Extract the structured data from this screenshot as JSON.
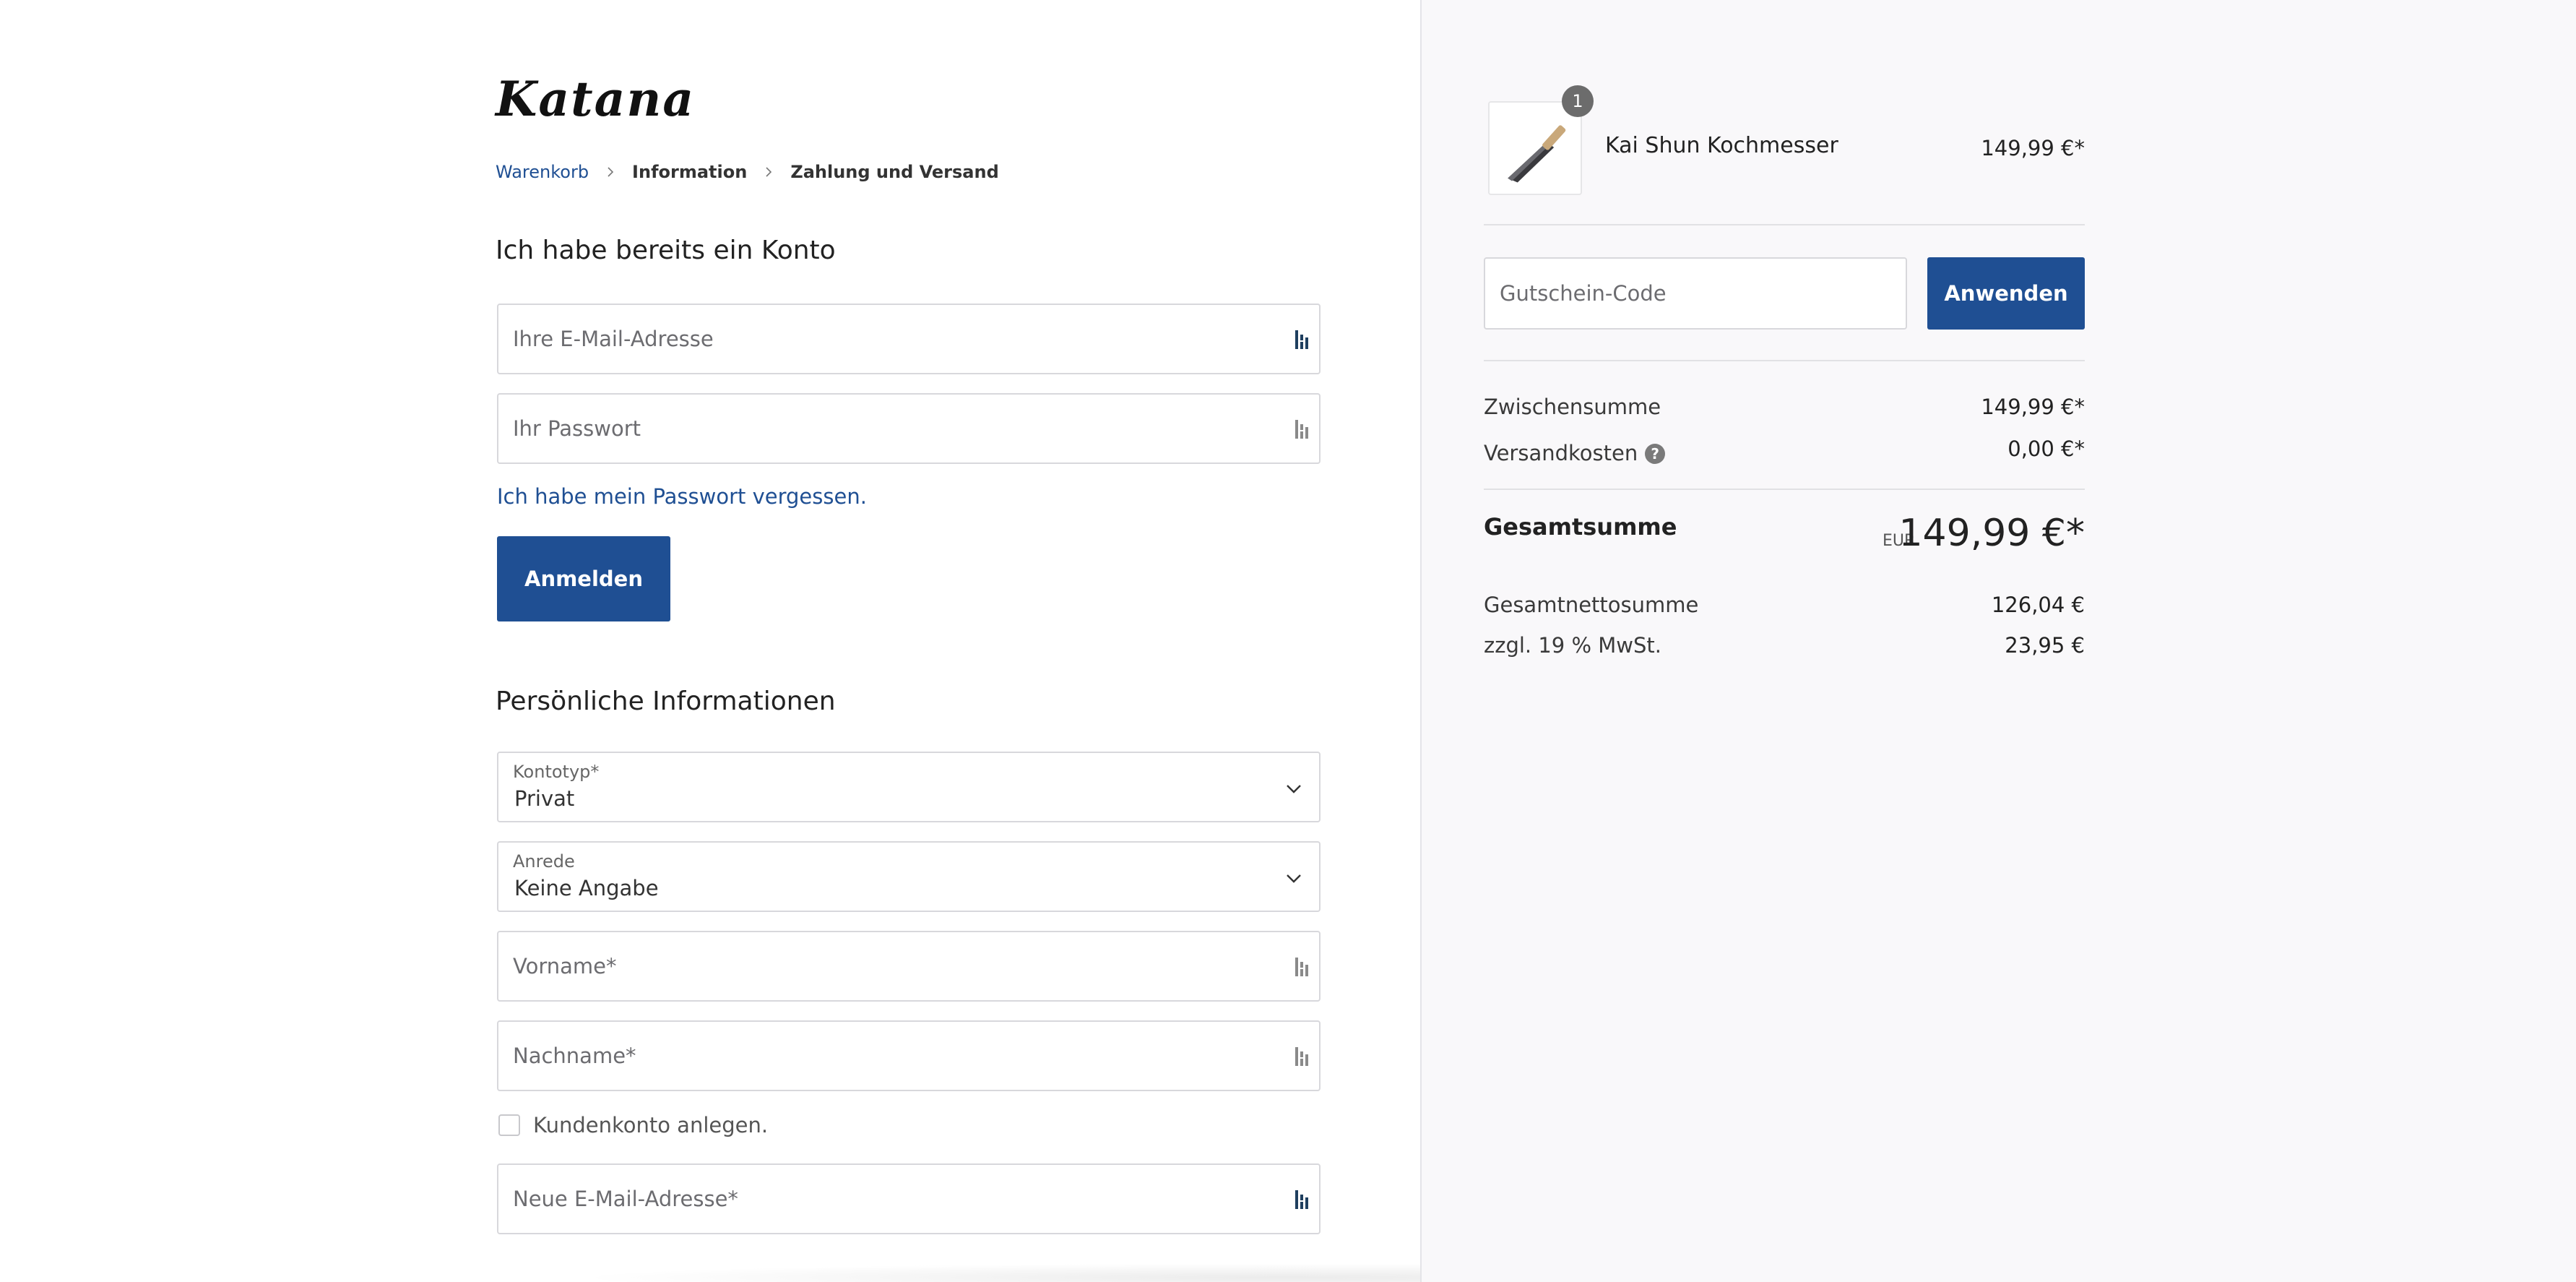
{
  "brand": {
    "logo_text": "Katana"
  },
  "breadcrumb": {
    "items": [
      "Warenkorb",
      "Information",
      "Zahlung und Versand"
    ]
  },
  "login": {
    "heading": "Ich habe bereits ein Konto",
    "email_placeholder": "Ihre E-Mail-Adresse",
    "password_placeholder": "Ihr Passwort",
    "forgot_link": "Ich habe mein Passwort vergessen.",
    "submit_label": "Anmelden"
  },
  "personal": {
    "heading": "Persönliche Informationen",
    "account_type": {
      "label": "Kontotyp*",
      "value": "Privat"
    },
    "salutation": {
      "label": "Anrede",
      "value": "Keine Angabe"
    },
    "firstname_placeholder": "Vorname*",
    "lastname_placeholder": "Nachname*",
    "create_account_label": "Kundenkonto anlegen.",
    "create_account_checked": false,
    "new_email_placeholder": "Neue E-Mail-Adresse*"
  },
  "cart": {
    "item": {
      "name": "Kai Shun Kochmesser",
      "quantity": "1",
      "price": "149,99 €*",
      "image_icon": "knife-icon"
    },
    "voucher": {
      "placeholder": "Gutschein-Code",
      "apply_label": "Anwenden"
    },
    "subtotal_label": "Zwischensumme",
    "subtotal_value": "149,99 €*",
    "shipping_label": "Versandkosten",
    "shipping_value": "0,00 €*",
    "total_label": "Gesamtsumme",
    "total_currency": "EUR",
    "total_value": "149,99 €*",
    "net_label": "Gesamtnettosumme",
    "net_value": "126,04 €",
    "tax_label": "zzgl. 19 % MwSt.",
    "tax_value": "23,95 €"
  },
  "colors": {
    "primary": "#1f4f93",
    "panel_background": "#f9f8fa",
    "border": "#d8d8dc"
  }
}
